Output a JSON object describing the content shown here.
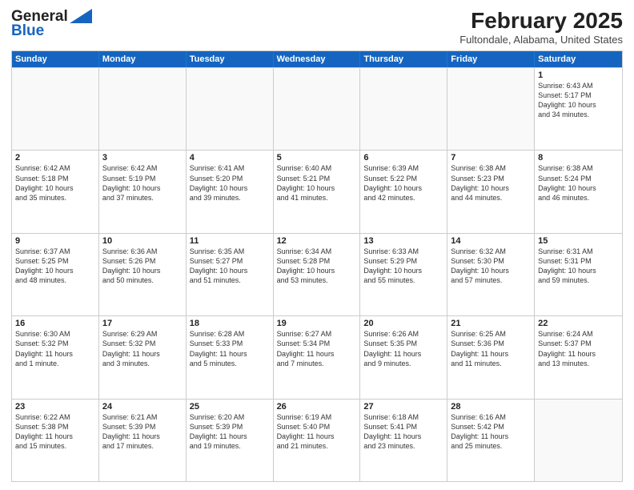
{
  "header": {
    "logo_general": "General",
    "logo_blue": "Blue",
    "month_title": "February 2025",
    "location": "Fultondale, Alabama, United States"
  },
  "weekdays": [
    "Sunday",
    "Monday",
    "Tuesday",
    "Wednesday",
    "Thursday",
    "Friday",
    "Saturday"
  ],
  "rows": [
    [
      {
        "day": "",
        "info": "",
        "empty": true
      },
      {
        "day": "",
        "info": "",
        "empty": true
      },
      {
        "day": "",
        "info": "",
        "empty": true
      },
      {
        "day": "",
        "info": "",
        "empty": true
      },
      {
        "day": "",
        "info": "",
        "empty": true
      },
      {
        "day": "",
        "info": "",
        "empty": true
      },
      {
        "day": "1",
        "info": "Sunrise: 6:43 AM\nSunset: 5:17 PM\nDaylight: 10 hours\nand 34 minutes.",
        "empty": false
      }
    ],
    [
      {
        "day": "2",
        "info": "Sunrise: 6:42 AM\nSunset: 5:18 PM\nDaylight: 10 hours\nand 35 minutes.",
        "empty": false
      },
      {
        "day": "3",
        "info": "Sunrise: 6:42 AM\nSunset: 5:19 PM\nDaylight: 10 hours\nand 37 minutes.",
        "empty": false
      },
      {
        "day": "4",
        "info": "Sunrise: 6:41 AM\nSunset: 5:20 PM\nDaylight: 10 hours\nand 39 minutes.",
        "empty": false
      },
      {
        "day": "5",
        "info": "Sunrise: 6:40 AM\nSunset: 5:21 PM\nDaylight: 10 hours\nand 41 minutes.",
        "empty": false
      },
      {
        "day": "6",
        "info": "Sunrise: 6:39 AM\nSunset: 5:22 PM\nDaylight: 10 hours\nand 42 minutes.",
        "empty": false
      },
      {
        "day": "7",
        "info": "Sunrise: 6:38 AM\nSunset: 5:23 PM\nDaylight: 10 hours\nand 44 minutes.",
        "empty": false
      },
      {
        "day": "8",
        "info": "Sunrise: 6:38 AM\nSunset: 5:24 PM\nDaylight: 10 hours\nand 46 minutes.",
        "empty": false
      }
    ],
    [
      {
        "day": "9",
        "info": "Sunrise: 6:37 AM\nSunset: 5:25 PM\nDaylight: 10 hours\nand 48 minutes.",
        "empty": false
      },
      {
        "day": "10",
        "info": "Sunrise: 6:36 AM\nSunset: 5:26 PM\nDaylight: 10 hours\nand 50 minutes.",
        "empty": false
      },
      {
        "day": "11",
        "info": "Sunrise: 6:35 AM\nSunset: 5:27 PM\nDaylight: 10 hours\nand 51 minutes.",
        "empty": false
      },
      {
        "day": "12",
        "info": "Sunrise: 6:34 AM\nSunset: 5:28 PM\nDaylight: 10 hours\nand 53 minutes.",
        "empty": false
      },
      {
        "day": "13",
        "info": "Sunrise: 6:33 AM\nSunset: 5:29 PM\nDaylight: 10 hours\nand 55 minutes.",
        "empty": false
      },
      {
        "day": "14",
        "info": "Sunrise: 6:32 AM\nSunset: 5:30 PM\nDaylight: 10 hours\nand 57 minutes.",
        "empty": false
      },
      {
        "day": "15",
        "info": "Sunrise: 6:31 AM\nSunset: 5:31 PM\nDaylight: 10 hours\nand 59 minutes.",
        "empty": false
      }
    ],
    [
      {
        "day": "16",
        "info": "Sunrise: 6:30 AM\nSunset: 5:32 PM\nDaylight: 11 hours\nand 1 minute.",
        "empty": false
      },
      {
        "day": "17",
        "info": "Sunrise: 6:29 AM\nSunset: 5:32 PM\nDaylight: 11 hours\nand 3 minutes.",
        "empty": false
      },
      {
        "day": "18",
        "info": "Sunrise: 6:28 AM\nSunset: 5:33 PM\nDaylight: 11 hours\nand 5 minutes.",
        "empty": false
      },
      {
        "day": "19",
        "info": "Sunrise: 6:27 AM\nSunset: 5:34 PM\nDaylight: 11 hours\nand 7 minutes.",
        "empty": false
      },
      {
        "day": "20",
        "info": "Sunrise: 6:26 AM\nSunset: 5:35 PM\nDaylight: 11 hours\nand 9 minutes.",
        "empty": false
      },
      {
        "day": "21",
        "info": "Sunrise: 6:25 AM\nSunset: 5:36 PM\nDaylight: 11 hours\nand 11 minutes.",
        "empty": false
      },
      {
        "day": "22",
        "info": "Sunrise: 6:24 AM\nSunset: 5:37 PM\nDaylight: 11 hours\nand 13 minutes.",
        "empty": false
      }
    ],
    [
      {
        "day": "23",
        "info": "Sunrise: 6:22 AM\nSunset: 5:38 PM\nDaylight: 11 hours\nand 15 minutes.",
        "empty": false
      },
      {
        "day": "24",
        "info": "Sunrise: 6:21 AM\nSunset: 5:39 PM\nDaylight: 11 hours\nand 17 minutes.",
        "empty": false
      },
      {
        "day": "25",
        "info": "Sunrise: 6:20 AM\nSunset: 5:39 PM\nDaylight: 11 hours\nand 19 minutes.",
        "empty": false
      },
      {
        "day": "26",
        "info": "Sunrise: 6:19 AM\nSunset: 5:40 PM\nDaylight: 11 hours\nand 21 minutes.",
        "empty": false
      },
      {
        "day": "27",
        "info": "Sunrise: 6:18 AM\nSunset: 5:41 PM\nDaylight: 11 hours\nand 23 minutes.",
        "empty": false
      },
      {
        "day": "28",
        "info": "Sunrise: 6:16 AM\nSunset: 5:42 PM\nDaylight: 11 hours\nand 25 minutes.",
        "empty": false
      },
      {
        "day": "",
        "info": "",
        "empty": true
      }
    ]
  ]
}
